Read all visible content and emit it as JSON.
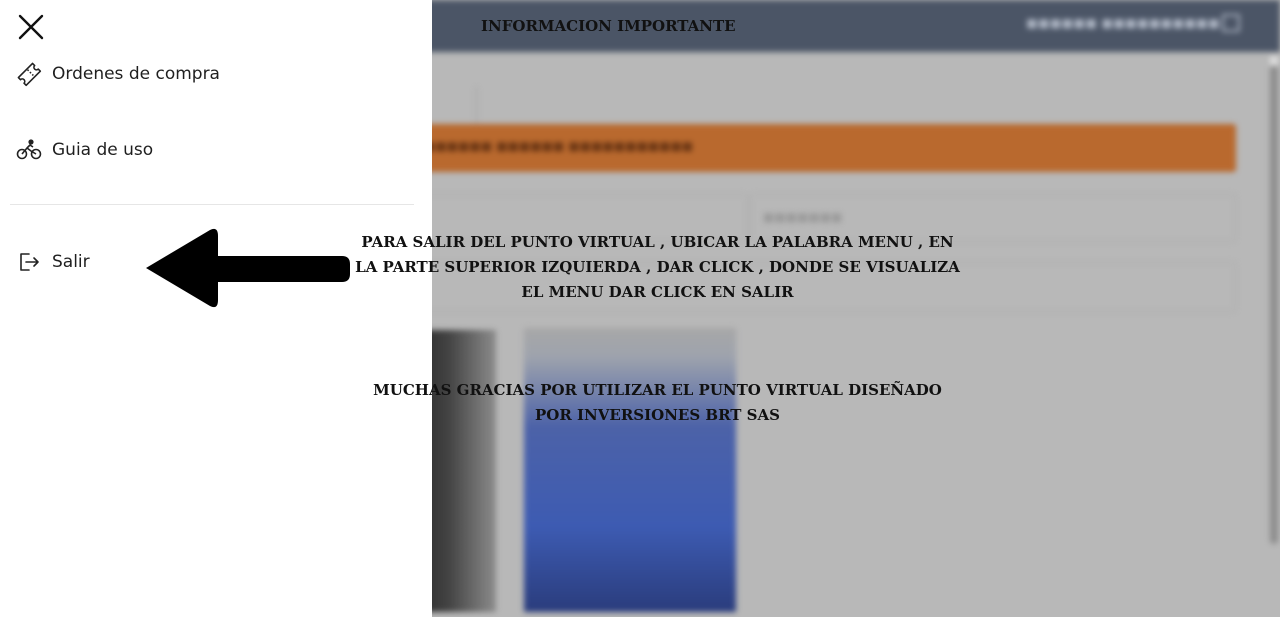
{
  "modal": {
    "title": "INFORMACION IMPORTANTE",
    "instructions": "PARA SALIR DEL PUNTO VIRTUAL , UBICAR LA PALABRA MENU , EN LA PARTE SUPERIOR IZQUIERDA , DAR CLICK , DONDE SE VISUALIZA EL MENU DAR CLICK EN SALIR",
    "thanks": "MUCHAS GRACIAS POR UTILIZAR EL PUNTO VIRTUAL DISEÑADO POR INVERSIONES BRT SAS"
  },
  "menu": {
    "close_icon": "close-icon",
    "items": [
      {
        "label": "Ordenes de compra",
        "icon": "ticket-icon"
      },
      {
        "label": "Guia de uso",
        "icon": "bicycle-icon"
      },
      {
        "label": "Salir",
        "icon": "logout-icon"
      }
    ]
  },
  "colors": {
    "header_bg": "#4b5566",
    "banner": "#b9692e",
    "menu_bg": "#ffffff",
    "overlay_bg": "#b8b8b8"
  }
}
